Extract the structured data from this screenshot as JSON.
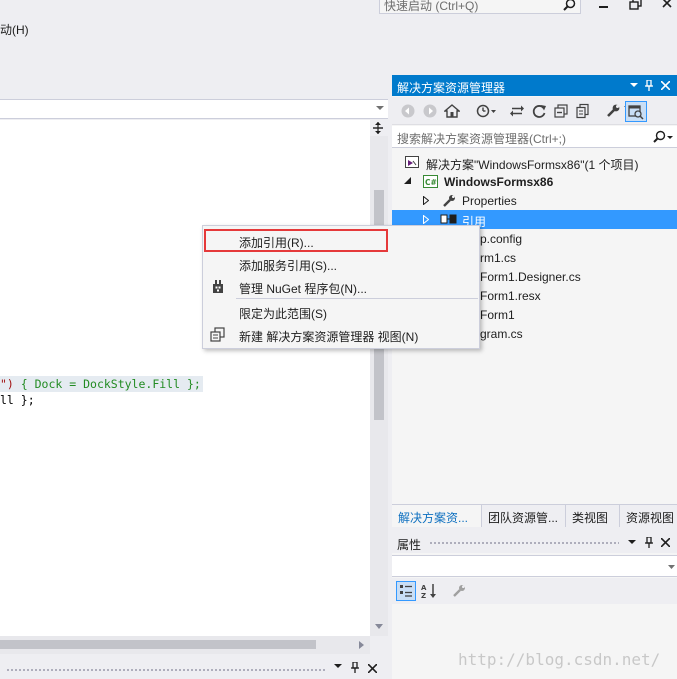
{
  "top": {
    "quick_launch_placeholder": "快速启动 (Ctrl+Q)",
    "menu_help": "动(H)"
  },
  "editor": {
    "code_lines": [
      {
        "pre": "\")",
        "body": " { Dock = DockStyle.Fill };"
      },
      {
        "body": "ll };"
      }
    ]
  },
  "solution_explorer": {
    "title": "解决方案资源管理器",
    "search_placeholder": "搜索解决方案资源管理器(Ctrl+;)",
    "tree": [
      {
        "label": "解决方案\"WindowsFormsx86\"(1 个项目)",
        "icon": "solution-icon"
      },
      {
        "label": "WindowsFormsx86",
        "icon": "csharp-project-icon",
        "bold": true
      },
      {
        "label": "Properties",
        "icon": "wrench-icon"
      },
      {
        "label": "引用",
        "icon": "references-icon",
        "selected": true
      },
      {
        "label": "p.config"
      },
      {
        "label": "rm1.cs"
      },
      {
        "label": "Form1.Designer.cs"
      },
      {
        "label": "Form1.resx"
      },
      {
        "label": "Form1"
      },
      {
        "label": "gram.cs"
      }
    ],
    "bottom_tabs": [
      "解决方案资...",
      "团队资源管...",
      "类视图",
      "资源视图"
    ]
  },
  "properties": {
    "title": "属性"
  },
  "context_menu": {
    "items": [
      {
        "label": "添加引用(R)...",
        "highlighted": true
      },
      {
        "label": "添加服务引用(S)..."
      },
      {
        "label": "管理 NuGet 程序包(N)...",
        "icon": "nuget-icon"
      },
      {
        "label": "限定为此范围(S)"
      },
      {
        "label": "新建 解决方案资源管理器 视图(N)",
        "icon": "new-view-icon"
      }
    ]
  },
  "watermark": "http://blog.csdn.net/",
  "colors": {
    "accent": "#007acc",
    "selection": "#3399ff",
    "highlight_border": "#e5393a"
  }
}
